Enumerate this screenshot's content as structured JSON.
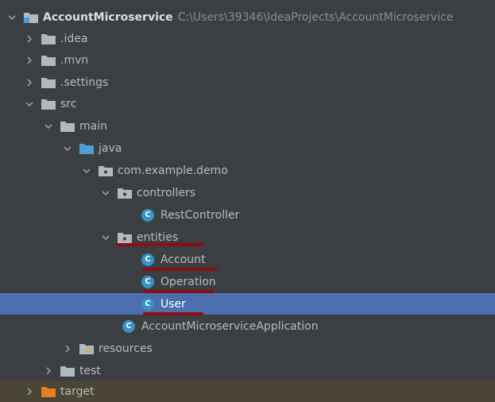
{
  "tree": {
    "root": {
      "label": "AccountMicroservice",
      "path": "C:\\Users\\39346\\IdeaProjects\\AccountMicroservice"
    },
    "idea": ".idea",
    "mvn": ".mvn",
    "settings": ".settings",
    "src": "src",
    "main": "main",
    "java": "java",
    "package": "com.example.demo",
    "controllers": "controllers",
    "rest_controller": "RestController",
    "entities": "entities",
    "account": "Account",
    "operation": "Operation",
    "user": "User",
    "application": "AccountMicroserviceApplication",
    "resources": "resources",
    "test": "test",
    "target": "target",
    "class_badge": "C"
  },
  "colors": {
    "background": "#3c3f41",
    "selection": "#4b6eaf",
    "folder": "#aeb9c0",
    "source_folder": "#4a9fd8",
    "excluded_folder": "#e87e1e",
    "class_icon": "#3592c4",
    "annotation_underline": "#8b0e12"
  },
  "selected_item": "User"
}
